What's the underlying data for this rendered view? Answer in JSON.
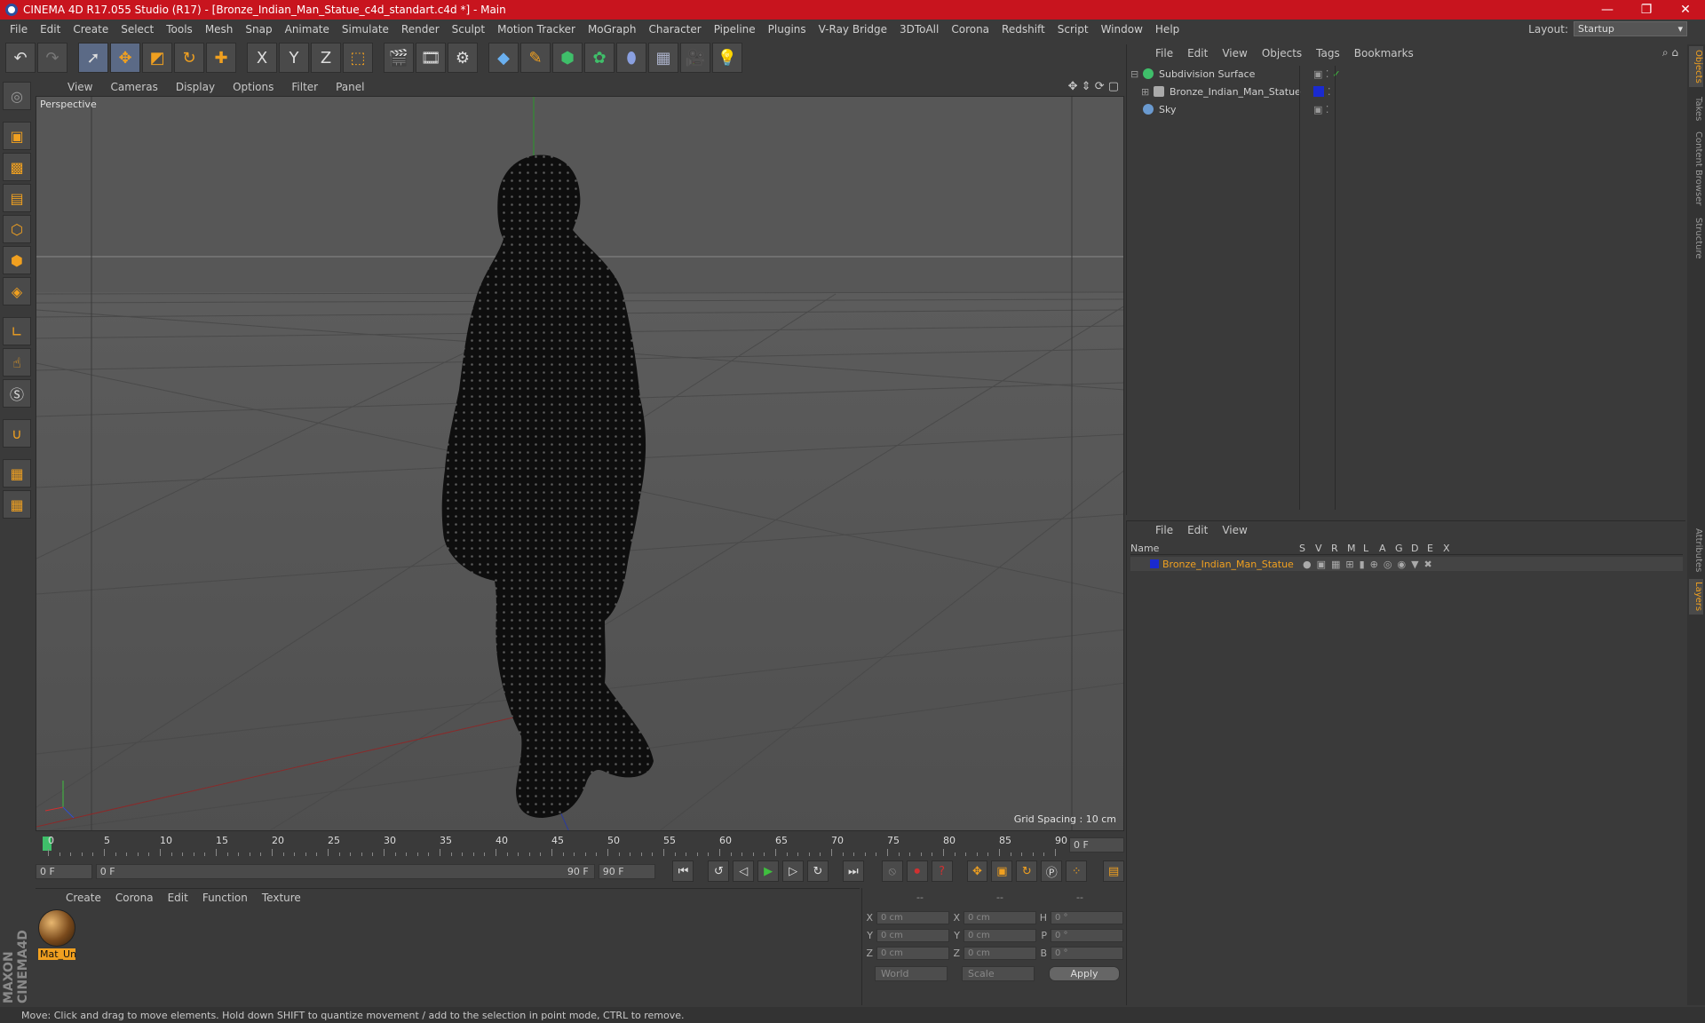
{
  "titlebar": {
    "title": "CINEMA 4D R17.055 Studio (R17) - [Bronze_Indian_Man_Statue_c4d_standart.c4d *] - Main",
    "minimize": "—",
    "maximize": "❐",
    "close": "✕"
  },
  "menubar": [
    "File",
    "Edit",
    "Create",
    "Select",
    "Tools",
    "Mesh",
    "Snap",
    "Animate",
    "Simulate",
    "Render",
    "Sculpt",
    "Motion Tracker",
    "MoGraph",
    "Character",
    "Pipeline",
    "Plugins",
    "V-Ray Bridge",
    "3DToAll",
    "Corona",
    "Redshift",
    "Script",
    "Window",
    "Help"
  ],
  "layout": {
    "label": "Layout:",
    "value": "Startup"
  },
  "toolbar": {
    "x": "X",
    "y": "Y",
    "z": "Z"
  },
  "viewport_menu": [
    "View",
    "Cameras",
    "Display",
    "Options",
    "Filter",
    "Panel"
  ],
  "viewport": {
    "label": "Perspective",
    "grid_spacing": "Grid Spacing : 10 cm"
  },
  "timeline": {
    "ticks": [
      "0",
      "5",
      "10",
      "15",
      "20",
      "25",
      "30",
      "35",
      "40",
      "45",
      "50",
      "55",
      "60",
      "65",
      "70",
      "75",
      "80",
      "85",
      "90"
    ],
    "current_frame": "0 F"
  },
  "transport": {
    "start": "0 F",
    "slider_start": "0 F",
    "slider_end": "90 F",
    "end": "90 F"
  },
  "material_menu": [
    "Create",
    "Corona",
    "Edit",
    "Function",
    "Texture"
  ],
  "material": {
    "name": "Mat_Un"
  },
  "coords": {
    "headers": [
      "--",
      "--",
      "--"
    ],
    "rows": [
      {
        "a1": "X",
        "v1": "0 cm",
        "a2": "X",
        "v2": "0 cm",
        "a3": "H",
        "v3": "0 °"
      },
      {
        "a1": "Y",
        "v1": "0 cm",
        "a2": "Y",
        "v2": "0 cm",
        "a3": "P",
        "v3": "0 °"
      },
      {
        "a1": "Z",
        "v1": "0 cm",
        "a2": "Z",
        "v2": "0 cm",
        "a3": "B",
        "v3": "0 °"
      }
    ],
    "world": "World",
    "scale": "Scale",
    "apply": "Apply"
  },
  "objects_menu": [
    "File",
    "Edit",
    "View",
    "Objects",
    "Tags",
    "Bookmarks"
  ],
  "objects": [
    {
      "name": "Subdivision Surface",
      "color": "#3fbf6a"
    },
    {
      "name": "Bronze_Indian_Man_Statue",
      "color": "#aaaaaa"
    },
    {
      "name": "Sky",
      "color": "#6a9ad0"
    }
  ],
  "layers_menu": [
    "File",
    "Edit",
    "View"
  ],
  "layers": {
    "columns": [
      "Name",
      "S",
      "V",
      "R",
      "M",
      "L",
      "A",
      "G",
      "D",
      "E",
      "X"
    ],
    "row_name": "Bronze_Indian_Man_Statue",
    "row_color": "#1a2ad0"
  },
  "sidetabs": [
    "Objects",
    "Takes",
    "Content Browser",
    "Structure",
    "Attributes",
    "Layers"
  ],
  "status": "Move: Click and drag to move elements. Hold down SHIFT to quantize movement / add to the selection in point mode, CTRL to remove.",
  "colors": {
    "accent": "#f0a020",
    "titlebar": "#c8141e",
    "selection": "#5b6a86"
  }
}
